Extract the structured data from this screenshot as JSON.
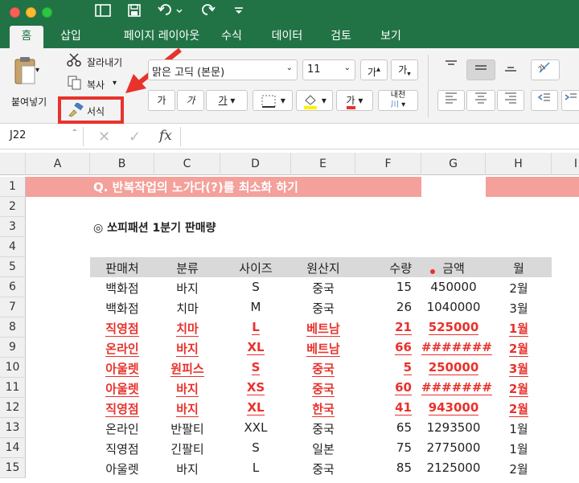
{
  "ribbon_tabs": [
    "홈",
    "삽입",
    "페이지 레이아웃",
    "수식",
    "데이터",
    "검토",
    "보기"
  ],
  "clipboard": {
    "paste": "붙여넣기",
    "cut": "잘라내기",
    "copy": "복사",
    "format_painter": "서식"
  },
  "font": {
    "name": "맑은 고딕 (본문)",
    "size": "11",
    "increase": "가",
    "decrease": "가",
    "bold": "가",
    "italic": "가",
    "underline": "가",
    "color_a": "가",
    "phonetic": "내천"
  },
  "name_box": "J22",
  "fx": "fx",
  "columns": [
    "A",
    "B",
    "C",
    "D",
    "E",
    "F",
    "G",
    "H",
    "I"
  ],
  "rows": [
    "1",
    "2",
    "3",
    "4",
    "5",
    "6",
    "7",
    "8",
    "9",
    "10",
    "11",
    "12",
    "13",
    "14",
    "15"
  ],
  "title_banner": "Q. 반복작업의 노가다(?)를 최소화 하기",
  "subtitle": "◎ 쏘피패션 1분기 판매량",
  "table": {
    "headers": [
      "판매처",
      "분류",
      "사이즈",
      "원산지",
      "수량",
      "금액",
      "월"
    ],
    "rows": [
      {
        "cells": [
          "백화점",
          "바지",
          "S",
          "중국",
          "15",
          "450000",
          "2월"
        ],
        "highlight": false
      },
      {
        "cells": [
          "백화점",
          "치마",
          "M",
          "중국",
          "26",
          "1040000",
          "3월"
        ],
        "highlight": false
      },
      {
        "cells": [
          "직영점",
          "치마",
          "L",
          "베트남",
          "21",
          "525000",
          "1월"
        ],
        "highlight": true
      },
      {
        "cells": [
          "온라인",
          "바지",
          "XL",
          "베트남",
          "66",
          "#######",
          "2월"
        ],
        "highlight": true
      },
      {
        "cells": [
          "아울렛",
          "원피스",
          "S",
          "중국",
          "5",
          "250000",
          "3월"
        ],
        "highlight": true
      },
      {
        "cells": [
          "아울렛",
          "바지",
          "XS",
          "중국",
          "60",
          "#######",
          "2월"
        ],
        "highlight": true
      },
      {
        "cells": [
          "직영점",
          "바지",
          "XL",
          "한국",
          "41",
          "943000",
          "2월"
        ],
        "highlight": true
      },
      {
        "cells": [
          "온라인",
          "반팔티",
          "XXL",
          "중국",
          "65",
          "1293500",
          "1월"
        ],
        "highlight": false
      },
      {
        "cells": [
          "직영점",
          "긴팔티",
          "S",
          "일본",
          "75",
          "2775000",
          "1월"
        ],
        "highlight": false
      },
      {
        "cells": [
          "아울렛",
          "바지",
          "L",
          "중국",
          "85",
          "2125000",
          "2월"
        ],
        "highlight": false
      }
    ]
  },
  "colors": {
    "accent": "#217346",
    "highlight": "#e8322c",
    "banner": "#f4a09b",
    "header_fill": "#d9d9d9"
  }
}
